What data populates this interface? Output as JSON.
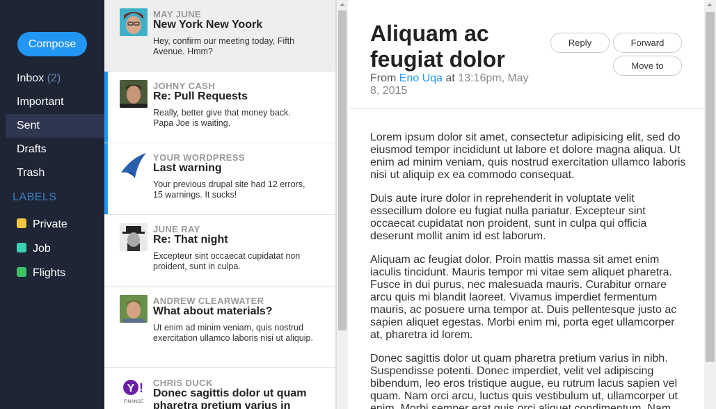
{
  "nav": {
    "compose": "Compose",
    "folders": [
      {
        "label": "Inbox",
        "count": "(2)"
      },
      {
        "label": "Important",
        "count": ""
      },
      {
        "label": "Sent",
        "count": ""
      },
      {
        "label": "Drafts",
        "count": ""
      },
      {
        "label": "Trash",
        "count": ""
      }
    ],
    "labels_heading": "LABELS",
    "labels": [
      {
        "label": "Private",
        "color": "#f5c342"
      },
      {
        "label": "Job",
        "color": "#3bd1b5"
      },
      {
        "label": "Flights",
        "color": "#3cc464"
      }
    ]
  },
  "messages": [
    {
      "sender": "MAY JUNE",
      "subject": "New York New Yoork",
      "preview": "Hey, confirm our meeting today, Fifth Avenue. Hmm?"
    },
    {
      "sender": "JOHNY CASH",
      "subject": "Re: Pull Requests",
      "preview": "Really, better give that money back. Papa Joe is waiting."
    },
    {
      "sender": "YOUR WORDPRESS",
      "subject": "Last warning",
      "preview": "Your previous drupal site had 12 errors, 15 warnings. It sucks!"
    },
    {
      "sender": "JUNE RAY",
      "subject": "Re: That night",
      "preview": "Excepteur sint occaecat cupidatat non proident, sunt in culpa."
    },
    {
      "sender": "ANDREW CLEARWATER",
      "subject": "What about materials?",
      "preview": "Ut enim ad minim veniam, quis nostrud exercitation ullamco laboris nisi ut aliquip."
    },
    {
      "sender": "CHRIS DUCK",
      "subject": "Donec sagittis dolor ut quam pharetra pretium varius in",
      "preview": "",
      "avatar_text": "FINANCE"
    }
  ],
  "reader": {
    "subject": "Aliquam ac feugiat dolor",
    "from_label": "From",
    "from_name": "Eno Uqa",
    "at_label": "at",
    "date": "13:16pm, May 8, 2015",
    "reply": "Reply",
    "forward": "Forward",
    "move_to": "Move to",
    "body": [
      "Lorem ipsum dolor sit amet, consectetur adipisicing elit, sed do eiusmod tempor incididunt ut labore et dolore magna aliqua. Ut enim ad minim veniam, quis nostrud exercitation ullamco laboris nisi ut aliquip ex ea commodo consequat.",
      "Duis aute irure dolor in reprehenderit in voluptate velit essecillum dolore eu fugiat nulla pariatur. Excepteur sint occaecat cupidatat non proident, sunt in culpa qui officia deserunt mollit anim id est laborum.",
      "Aliquam ac feugiat dolor. Proin mattis massa sit amet enim iaculis tincidunt. Mauris tempor mi vitae sem aliquet pharetra. Fusce in dui purus, nec malesuada mauris. Curabitur ornare arcu quis mi blandit laoreet. Vivamus imperdiet fermentum mauris, ac posuere urna tempor at. Duis pellentesque justo ac sapien aliquet egestas. Morbi enim mi, porta eget ullamcorper at, pharetra id lorem.",
      "Donec sagittis dolor ut quam pharetra pretium varius in nibh. Suspendisse potenti. Donec imperdiet, velit vel adipiscing bibendum, leo eros tristique augue, eu rutrum lacus sapien vel quam. Nam orci arcu, luctus quis vestibulum ut, ullamcorper ut enim. Morbi semper erat quis orci aliquet condimentum. Nam"
    ]
  },
  "colors": {
    "accent": "#2196f3",
    "sidebar": "#1e2535"
  }
}
